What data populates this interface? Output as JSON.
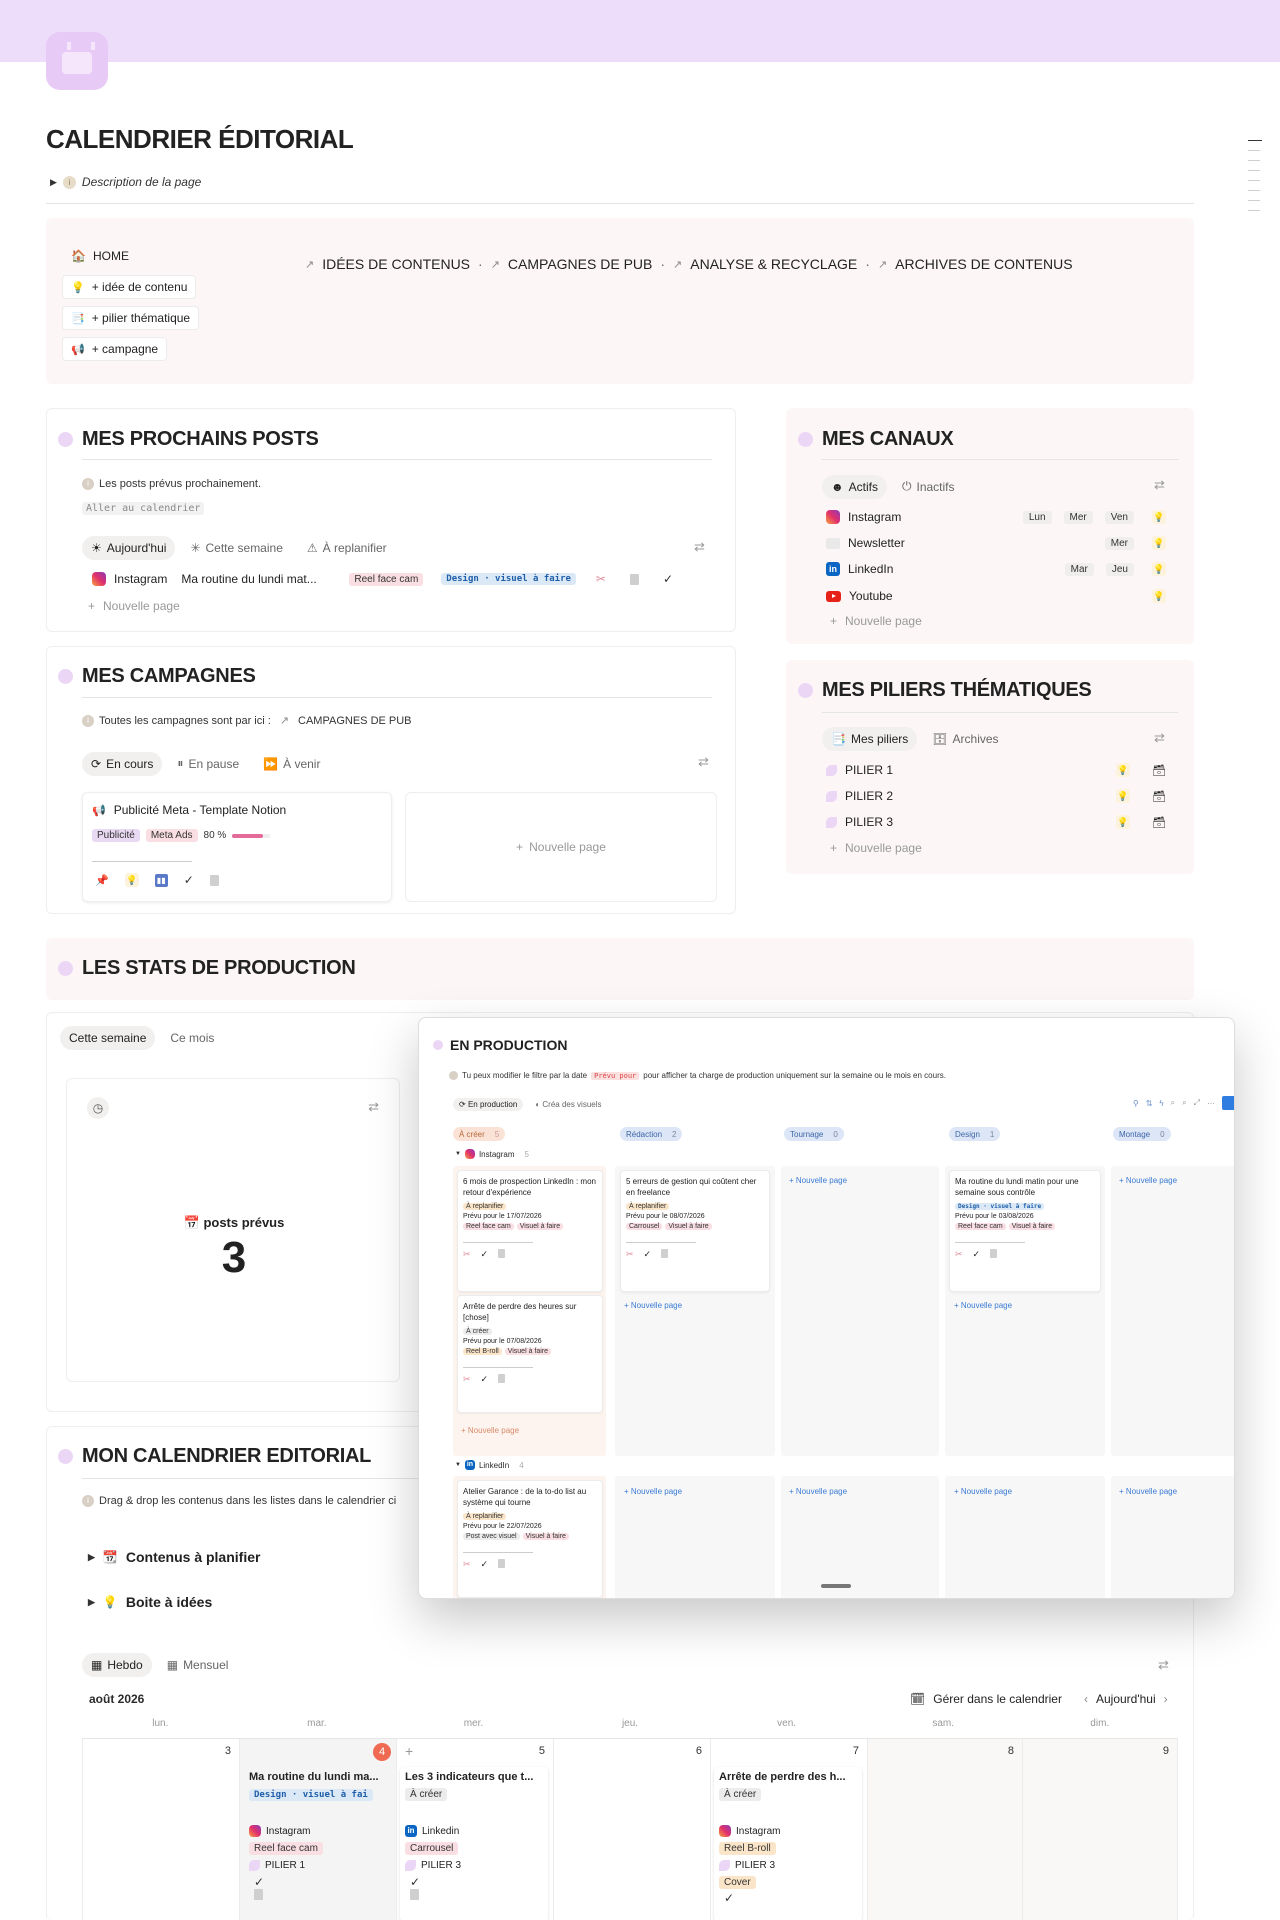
{
  "page": {
    "title": "CALENDRIER ÉDITORIAL",
    "description_toggle": "Description de la page"
  },
  "nav": {
    "side_buttons": [
      "HOME",
      "+ idée de contenu",
      "+ pilier thématique",
      "+ campagne"
    ],
    "top_links": [
      "IDÉES DE CONTENUS",
      "CAMPAGNES DE PUB",
      "ANALYSE & RECYCLAGE",
      "ARCHIVES DE CONTENUS"
    ],
    "separator": "·"
  },
  "posts": {
    "title": "MES PROCHAINS POSTS",
    "info": "Les posts prévus prochainement.",
    "calendar_link": "Aller au calendrier",
    "tabs": [
      "Aujourd'hui",
      "Cette semaine",
      "À replanifier"
    ],
    "row": {
      "channel": "Instagram",
      "title": "Ma routine du lundi mat...",
      "format": "Reel face cam",
      "status": "Design · visuel à faire"
    },
    "new_page": "Nouvelle page"
  },
  "canaux": {
    "title": "MES CANAUX",
    "tabs": [
      "Actifs",
      "Inactifs"
    ],
    "items": [
      {
        "name": "Instagram",
        "days": [
          "Lun",
          "Mer",
          "Ven"
        ]
      },
      {
        "name": "Newsletter",
        "days": [
          "Mer"
        ]
      },
      {
        "name": "LinkedIn",
        "days": [
          "Mar",
          "Jeu"
        ]
      },
      {
        "name": "Youtube",
        "days": []
      }
    ],
    "new_page": "Nouvelle page"
  },
  "campagnes": {
    "title": "MES CAMPAGNES",
    "info_prefix": "Toutes les campagnes sont par ici :",
    "info_link": "CAMPAGNES DE PUB",
    "tabs": [
      "En cours",
      "En pause",
      "À venir"
    ],
    "card": {
      "title": "Publicité Meta - Template Notion",
      "tags": [
        "Publicité",
        "Meta Ads"
      ],
      "progress_label": "80 %",
      "progress": 0.8
    },
    "new_page": "Nouvelle page"
  },
  "piliers": {
    "title": "MES PILIERS THÉMATIQUES",
    "tabs": [
      "Mes piliers",
      "Archives"
    ],
    "items": [
      "PILIER 1",
      "PILIER 2",
      "PILIER 3"
    ],
    "new_page": "Nouvelle page"
  },
  "stats": {
    "title": "LES STATS DE PRODUCTION",
    "tabs": [
      "Cette semaine",
      "Ce mois"
    ],
    "metric_label": "posts prévus",
    "metric_value": "3"
  },
  "production": {
    "title": "EN PRODUCTION",
    "info_prefix": "Tu peux modifier le filtre par la date",
    "info_code": "Prévu pour",
    "info_suffix": "pour afficher ta charge de production uniquement sur la semaine ou le mois en cours.",
    "tabs": [
      "En production",
      "Créa des visuels"
    ],
    "columns": [
      {
        "name": "À créer",
        "count": "5"
      },
      {
        "name": "Rédaction",
        "count": "2"
      },
      {
        "name": "Tournage",
        "count": "0"
      },
      {
        "name": "Design",
        "count": "1"
      },
      {
        "name": "Montage",
        "count": "0"
      }
    ],
    "groups": [
      {
        "name": "Instagram",
        "count": "5"
      },
      {
        "name": "LinkedIn",
        "count": "4"
      }
    ],
    "cards": [
      {
        "title": "6 mois de prospection LinkedIn : mon retour d'expérience",
        "status": "À replanifier",
        "date": "Prévu pour le 17/07/2026",
        "tags": [
          "Reel face cam",
          "Visuel à faire"
        ]
      },
      {
        "title": "5 erreurs de gestion qui coûtent cher en freelance",
        "status": "À replanifier",
        "date": "Prévu pour le 08/07/2026",
        "tags": [
          "Carrousel",
          "Visuel à faire"
        ]
      },
      {
        "title": "Ma routine du lundi matin pour une semaine sous contrôle",
        "status": "Design · visuel à faire",
        "date": "Prévu pour le 03/08/2026",
        "tags": [
          "Reel face cam",
          "Visuel à faire"
        ]
      },
      {
        "title": "Arrête de perdre des heures sur [chose]",
        "status": "À créer",
        "date": "Prévu pour le 07/08/2026",
        "tags": [
          "Reel B-roll",
          "Visuel à faire"
        ]
      },
      {
        "title": "Atelier Garance : de la to-do list au système qui tourne",
        "status": "À replanifier",
        "date": "Prévu pour le 22/07/2026",
        "tags": [
          "Post avec visuel",
          "Visuel à faire"
        ]
      }
    ],
    "new_page": "Nouvelle page"
  },
  "calendar": {
    "title": "MON CALENDRIER EDITORIAL",
    "info": "Drag & drop les contenus dans les listes dans le calendrier ci",
    "toggles": [
      "Contenus à planifier",
      "Boite à idées"
    ],
    "tabs": [
      "Hebdo",
      "Mensuel"
    ],
    "month": "août 2026",
    "manage": "Gérer dans le calendrier",
    "today": "Aujourd'hui",
    "weekdays": [
      "lun.",
      "mar.",
      "mer.",
      "jeu.",
      "ven.",
      "sam.",
      "dim."
    ],
    "days": [
      "3",
      "4",
      "5",
      "6",
      "7",
      "8",
      "9"
    ],
    "events": [
      {
        "title": "Ma routine du lundi ma...",
        "status": "Design · visuel à fai",
        "channel": "Instagram",
        "format": "Reel face cam",
        "pillar": "PILIER 1"
      },
      {
        "title": "Les 3 indicateurs que t...",
        "status": "À créer",
        "channel": "Linkedin",
        "format": "Carrousel",
        "pillar": "PILIER 3"
      },
      {
        "title": "Arrête de perdre des h...",
        "status": "À créer",
        "channel": "Instagram",
        "format": "Reel B-roll",
        "pillar": "PILIER 3",
        "extra": "Cover"
      }
    ]
  },
  "colors": {
    "banner": "#eedcfb",
    "accent_dot": "#ecd6f6",
    "today_badge": "#f06a52",
    "progress": "#e46a9a"
  }
}
